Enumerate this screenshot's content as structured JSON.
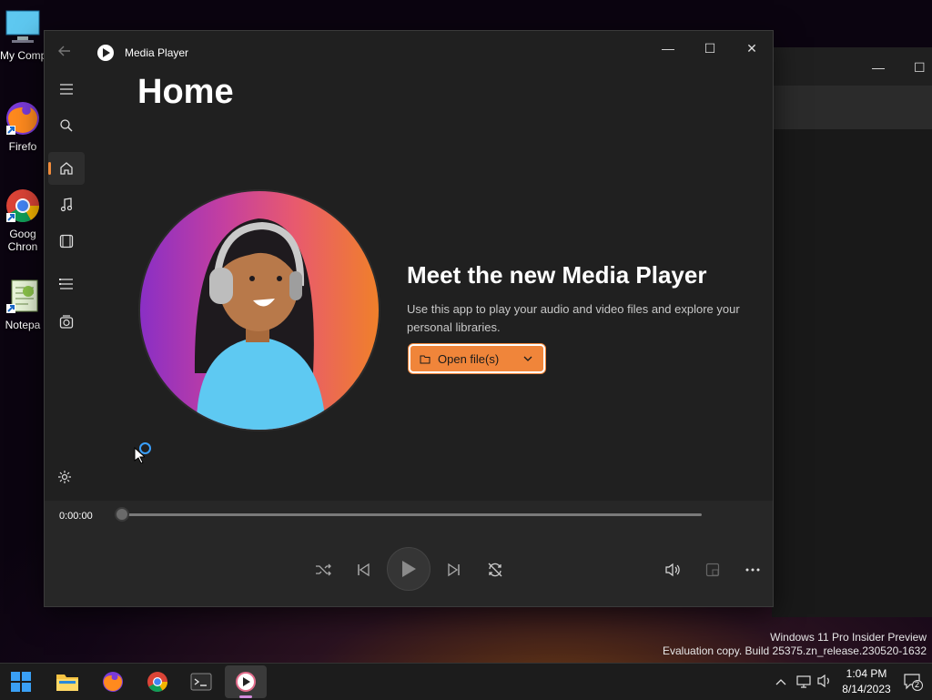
{
  "desktop": {
    "icons": [
      {
        "label": "My Comp",
        "icon": "computer-icon"
      },
      {
        "label": "Firefo",
        "icon": "firefox-icon"
      },
      {
        "label": "Goog\nChron",
        "icon": "chrome-icon"
      },
      {
        "label": "Notepa",
        "icon": "notepad-icon"
      }
    ]
  },
  "background_window": {
    "minimize": "—",
    "maximize": "☐"
  },
  "window": {
    "app_title": "Media Player",
    "controls": {
      "minimize": "—",
      "maximize": "☐",
      "close": "✕"
    }
  },
  "nav": {
    "items": [
      "menu-icon",
      "search-icon",
      "home-icon",
      "music-icon",
      "video-icon",
      "playlist-icon",
      "radio-icon"
    ],
    "active": "home-icon"
  },
  "page": {
    "title": "Home",
    "promo_title": "Meet the new Media Player",
    "promo_text": "Use this app to play your audio and video files and explore your personal libraries.",
    "open_button": "Open file(s)"
  },
  "player": {
    "time": "0:00:00",
    "progress": 0,
    "controls": [
      "shuffle-icon",
      "previous-icon",
      "play-icon",
      "next-icon",
      "repeat-icon",
      "volume-icon",
      "miniplayer-icon",
      "more-icon"
    ]
  },
  "watermark": {
    "line1": "Windows 11 Pro Insider Preview",
    "line2": "Evaluation copy. Build 25375.zn_release.230520-1632"
  },
  "taskbar": {
    "apps": [
      "start-icon",
      "file-explorer-icon",
      "firefox-icon",
      "chrome-icon",
      "terminal-icon",
      "media-player-icon"
    ],
    "clock_time": "1:04 PM",
    "clock_date": "8/14/2023",
    "notification_count": "2"
  },
  "colors": {
    "accent": "#f0853a",
    "window_bg": "#202020",
    "player_bar_bg": "#272727",
    "loading": "#3aa0ff"
  }
}
